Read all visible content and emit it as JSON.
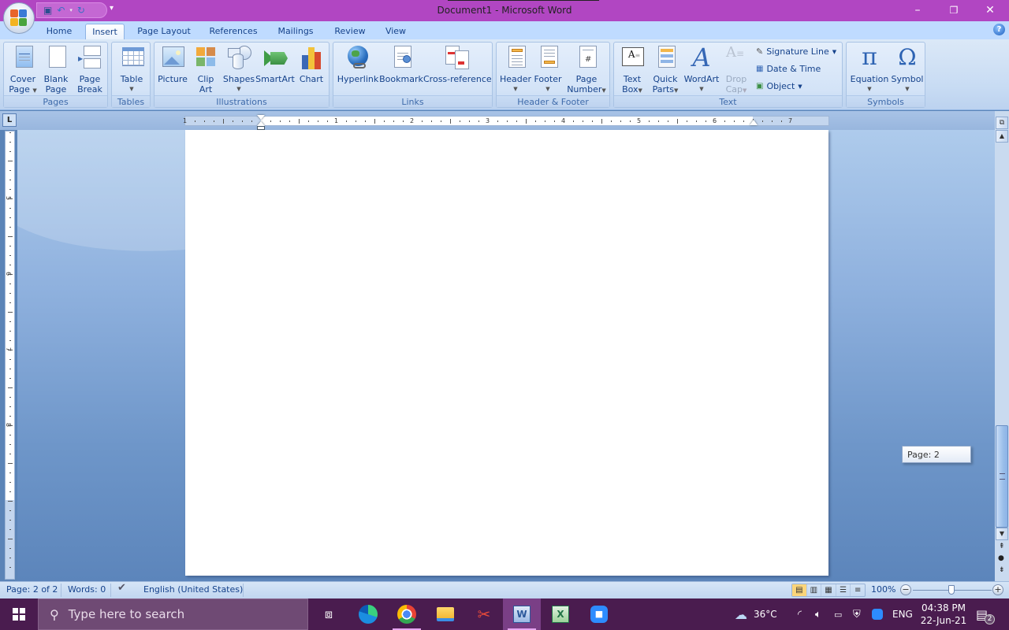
{
  "window": {
    "title": "Document1 - Microsoft Word",
    "controls": {
      "minimize": "–",
      "restore": "❐",
      "close": "✕"
    }
  },
  "quick_access": {
    "items": [
      {
        "name": "save-icon",
        "glyph": "💾"
      },
      {
        "name": "undo-icon",
        "glyph": "↶"
      },
      {
        "name": "redo-icon",
        "glyph": "↻"
      }
    ],
    "more_glyph": "▾"
  },
  "tabs": [
    {
      "label": "Home"
    },
    {
      "label": "Insert",
      "active": true
    },
    {
      "label": "Page Layout"
    },
    {
      "label": "References"
    },
    {
      "label": "Mailings"
    },
    {
      "label": "Review"
    },
    {
      "label": "View"
    }
  ],
  "help_glyph": "?",
  "ribbon": {
    "groups": {
      "pages": {
        "label": "Pages",
        "cover_page": {
          "line1": "Cover",
          "line2": "Page"
        },
        "blank_page": {
          "line1": "Blank",
          "line2": "Page"
        },
        "page_break": {
          "line1": "Page",
          "line2": "Break"
        }
      },
      "tables": {
        "label": "Tables",
        "table": {
          "line1": "Table"
        }
      },
      "illustrations": {
        "label": "Illustrations",
        "picture": {
          "line1": "Picture"
        },
        "clip_art": {
          "line1": "Clip",
          "line2": "Art"
        },
        "shapes": {
          "line1": "Shapes"
        },
        "smartart": {
          "line1": "SmartArt"
        },
        "chart": {
          "line1": "Chart"
        }
      },
      "links": {
        "label": "Links",
        "hyperlink": {
          "line1": "Hyperlink"
        },
        "bookmark": {
          "line1": "Bookmark"
        },
        "cross_reference": {
          "line1": "Cross-reference"
        }
      },
      "header_footer": {
        "label": "Header & Footer",
        "header": {
          "line1": "Header"
        },
        "footer": {
          "line1": "Footer"
        },
        "page_number": {
          "line1": "Page",
          "line2": "Number"
        }
      },
      "text": {
        "label": "Text",
        "text_box": {
          "line1": "Text",
          "line2": "Box"
        },
        "quick_parts": {
          "line1": "Quick",
          "line2": "Parts"
        },
        "wordart": {
          "line1": "WordArt"
        },
        "drop_cap": {
          "line1": "Drop",
          "line2": "Cap"
        },
        "signature_line": "Signature Line",
        "date_time": "Date & Time",
        "object": "Object"
      },
      "symbols": {
        "label": "Symbols",
        "equation": {
          "line1": "Equation",
          "glyph": "π"
        },
        "symbol": {
          "line1": "Symbol",
          "glyph": "Ω"
        }
      }
    }
  },
  "ruler": {
    "corner_glyph": "L",
    "horizontal_numbers": [
      "1",
      "1",
      "2",
      "3",
      "4",
      "5",
      "6",
      "7"
    ],
    "vertical_numbers": [
      "5",
      "6",
      "7",
      "8"
    ]
  },
  "document": {
    "page_tooltip": "Page: 2"
  },
  "statusbar": {
    "page": "Page: 2 of 2",
    "words": "Words: 0",
    "language": "English (United States)",
    "zoom": "100%",
    "zoom_percent": 100,
    "views": [
      "Print Layout",
      "Full Screen Reading",
      "Web Layout",
      "Outline",
      "Draft"
    ],
    "active_view": "Print Layout"
  },
  "taskbar": {
    "search_placeholder": "Type here to search",
    "apps": [
      "Task View",
      "Microsoft Edge",
      "Google Chrome",
      "File Explorer",
      "Snipping Tool",
      "Microsoft Word",
      "Microsoft Excel",
      "Zoom"
    ],
    "active_app": "Microsoft Word",
    "weather": "36°C",
    "language": "ENG",
    "time": "04:38 PM",
    "date": "22-Jun-21",
    "notifications": "2"
  }
}
